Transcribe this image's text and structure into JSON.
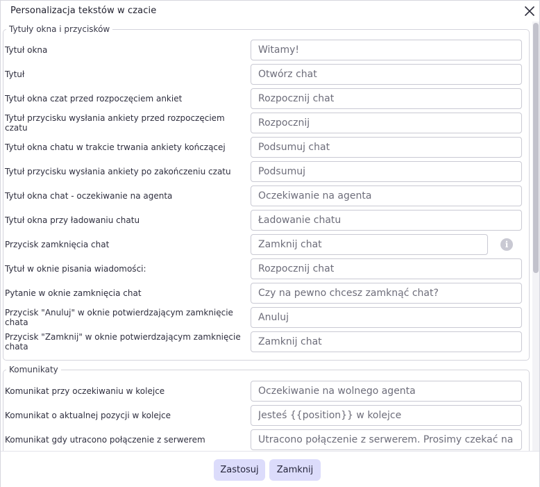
{
  "dialog": {
    "title": "Personalizacja tekstów w czacie",
    "close_icon": "close-icon"
  },
  "sections": [
    {
      "legend": "Tytuły okna i przycisków",
      "rows": [
        {
          "label": "Tytuł okna",
          "value": "Witamy!"
        },
        {
          "label": "Tytuł",
          "value": "Otwórz chat"
        },
        {
          "label": "Tytuł okna czat przed rozpoczęciem ankiet",
          "value": "Rozpocznij chat"
        },
        {
          "label": "Tytuł przycisku wysłania ankiety przed rozpoczęciem czatu",
          "value": "Rozpocznij"
        },
        {
          "label": "Tytuł okna chatu w trakcie trwania ankiety kończącej",
          "value": "Podsumuj chat"
        },
        {
          "label": "Tytuł przycisku wysłania ankiety po zakończeniu czatu",
          "value": "Podsumuj"
        },
        {
          "label": "Tytuł okna chat - oczekiwanie na agenta",
          "value": "Oczekiwanie na agenta"
        },
        {
          "label": "Tytuł okna przy ładowaniu chatu",
          "value": "Ładowanie chatu"
        },
        {
          "label": "Przycisk zamknięcia chat",
          "value": "Zamknij chat",
          "info_icon": "info-icon"
        },
        {
          "label": "Tytuł w oknie pisania wiadomości:",
          "value": "Rozpocznij chat"
        },
        {
          "label": "Pytanie w oknie zamknięcia chat",
          "value": "Czy na pewno chcesz zamknąć chat?"
        },
        {
          "label": "Przycisk \"Anuluj\" w oknie potwierdzającym zamknięcie chata",
          "value": "Anuluj"
        },
        {
          "label": "Przycisk \"Zamknij\" w oknie potwierdzającym zamknięcie chata",
          "value": "Zamknij chat"
        }
      ]
    },
    {
      "legend": "Komunikaty",
      "rows": [
        {
          "label": "Komunikat przy oczekiwaniu w kolejce",
          "value": "Oczekiwanie na wolnego agenta"
        },
        {
          "label": "Komunikat o aktualnej pozycji w kolejce",
          "value": "Jesteś {{position}} w kolejce"
        },
        {
          "label": "Komunikat gdy utracono połączenie z serwerem",
          "value": "Utracono połączenie z serwerem. Prosimy czekać na je"
        }
      ]
    }
  ],
  "footer": {
    "apply_label": "Zastosuj",
    "close_label": "Zamknij"
  },
  "colors": {
    "button_bg": "#dcdcfb",
    "border": "#c9c9d3"
  }
}
